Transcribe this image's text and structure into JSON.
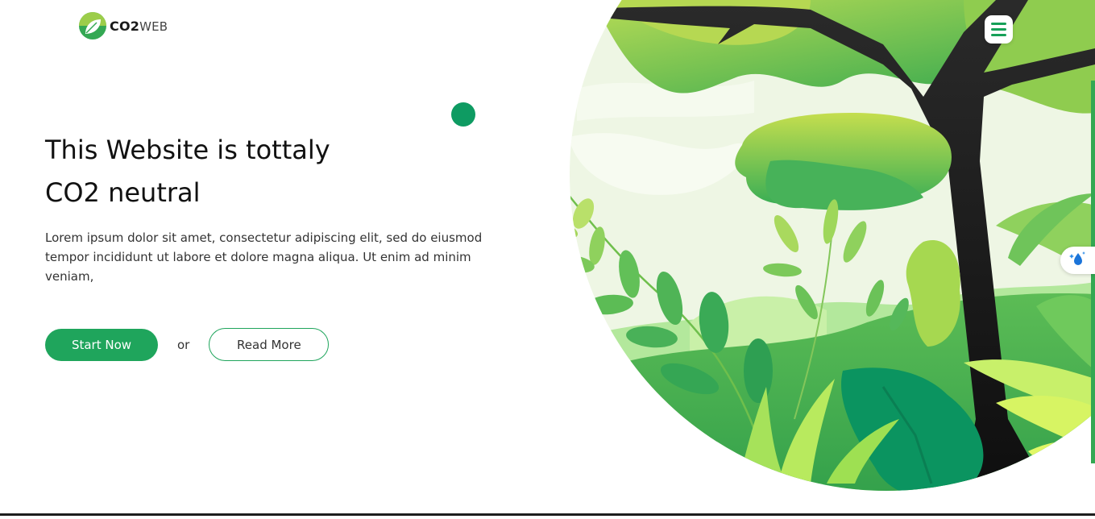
{
  "brand": {
    "name_part1": "CO2",
    "name_part2": "WEB"
  },
  "hero": {
    "title_line1": "This Website is tottaly",
    "title_line2": "CO2 neutral",
    "description": "Lorem ipsum dolor sit amet, consectetur adipiscing elit, sed do eiusmod tempor incididunt ut labore et dolore magna aliqua. Ut enim ad minim veniam,"
  },
  "cta": {
    "primary_label": "Start Now",
    "separator": "or",
    "secondary_label": "Read More"
  },
  "icons": {
    "logo": "leaf-logo-icon",
    "menu": "hamburger-menu-icon",
    "eco_widget": "water-drop-sparkle-icon"
  },
  "colors": {
    "brand_green": "#1fa55c",
    "dark_green": "#0e9b62",
    "light_green": "#b5d94d",
    "tree_trunk": "#1e1e1e"
  }
}
